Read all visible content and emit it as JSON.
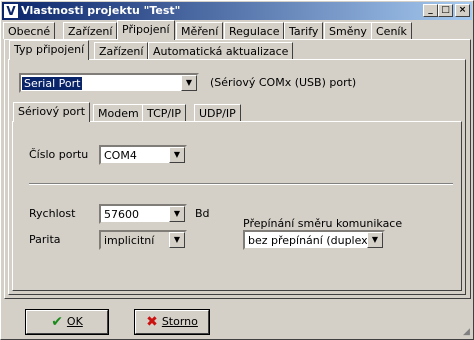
{
  "window": {
    "title": "Vlastnosti projektu \"Test\"",
    "icon_letter": "V",
    "controls": {
      "minimize": "_",
      "maximize": "□",
      "close": "×"
    }
  },
  "main_tabs": [
    "Obecné",
    "Zařízení",
    "Připojení",
    "Měření",
    "Regulace",
    "Tarify",
    "Směny",
    "Ceník"
  ],
  "sub_tabs": [
    "Typ připojení",
    "Zařízení",
    "Automatická aktualizace"
  ],
  "connection": {
    "type_value": "Serial Port",
    "type_description": "(Sériový COMx (USB) port)"
  },
  "inner_tabs": [
    "Sériový port",
    "Modem",
    "TCP/IP",
    "UDP/IP"
  ],
  "serial": {
    "port_label": "Číslo portu",
    "port_value": "COM4",
    "speed_label": "Rychlost",
    "speed_value": "57600",
    "speed_unit": "Bd",
    "parity_label": "Parita",
    "parity_value": "implicitní",
    "direction_label": "Přepínání směru komunikace",
    "direction_value": "bez přepínání (duplex)"
  },
  "buttons": {
    "ok": "OK",
    "cancel": "Storno"
  }
}
